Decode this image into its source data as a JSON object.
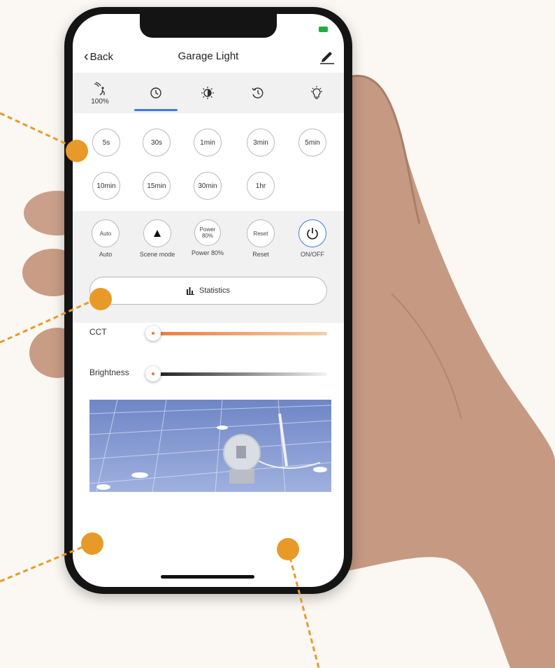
{
  "colors": {
    "accent": "#3b7bea",
    "marker": "#e89a28",
    "cct_start": "#e9773a",
    "phone_body": "#141414"
  },
  "header": {
    "back_label": "Back",
    "title": "Garage Light",
    "edit_icon": "pencil-icon"
  },
  "tabs": [
    {
      "icon": "motion-sensor-icon",
      "sub": "100%"
    },
    {
      "icon": "clock-icon",
      "selected": true
    },
    {
      "icon": "brightness-icon"
    },
    {
      "icon": "timer-icon"
    },
    {
      "icon": "bulb-icon"
    }
  ],
  "time_options": [
    "5s",
    "30s",
    "1min",
    "3min",
    "5min",
    "10min",
    "15min",
    "30min",
    "1hr"
  ],
  "modes": [
    {
      "circle": "Auto",
      "label": "Auto"
    },
    {
      "icon": "triangle-icon",
      "label": "Scene mode"
    },
    {
      "circle": "Power 80%",
      "label": "Power 80%"
    },
    {
      "circle": "Reset",
      "label": "Reset"
    },
    {
      "icon": "power-icon",
      "label": "ON/OFF"
    }
  ],
  "statistics_label": "Statistics",
  "sliders": {
    "cct": {
      "label": "CCT",
      "value": 0.0
    },
    "brightness": {
      "label": "Brightness",
      "value": 0.0
    }
  }
}
